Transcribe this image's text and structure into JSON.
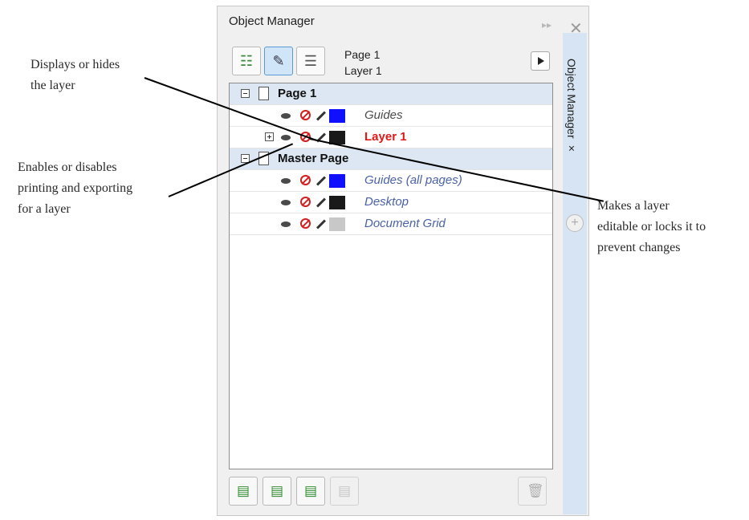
{
  "annotations": {
    "display": "Displays or hides\nthe layer",
    "print": "Enables or disables\nprinting and exporting\nfor a layer",
    "lock": "Makes a layer\neditable or locks it to\nprevent changes"
  },
  "panel": {
    "title": "Object Manager",
    "side_tab": "Object Manager ×",
    "current_page": "Page 1",
    "current_layer": "Layer 1"
  },
  "tree": [
    {
      "type": "page",
      "label": "Page 1"
    },
    {
      "type": "layer",
      "label": "Guides",
      "color": "#1010ff",
      "name_color": "#4a4a4a"
    },
    {
      "type": "layer",
      "label": "Layer 1",
      "color": "#1a1a1a",
      "name_color": "#e01818",
      "expandable": true
    },
    {
      "type": "page",
      "label": "Master Page"
    },
    {
      "type": "layer",
      "label": "Guides (all pages)",
      "color": "#1010ff",
      "name_color": "#4a62a6"
    },
    {
      "type": "layer",
      "label": "Desktop",
      "color": "#1a1a1a",
      "name_color": "#4a62a6"
    },
    {
      "type": "layer",
      "label": "Document Grid",
      "color": "#c8c8c8",
      "name_color": "#4a62a6"
    }
  ],
  "icons": {
    "close": "close-icon",
    "pin": "double-arrow-icon",
    "next": "play-arrow-icon"
  }
}
